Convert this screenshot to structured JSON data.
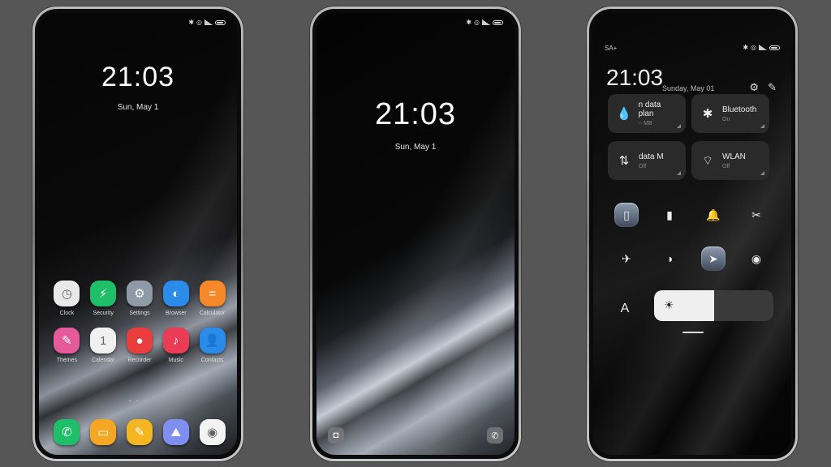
{
  "background_color": "#565656",
  "home_screen": {
    "time": "21:03",
    "date": "Sun, May 1",
    "apps": [
      {
        "label": "Clock",
        "icon": "clock-icon",
        "glyph": "◷",
        "color": "#e9e9e9"
      },
      {
        "label": "Security",
        "icon": "shield-icon",
        "glyph": "⚡",
        "color": "#1fbf6a"
      },
      {
        "label": "Settings",
        "icon": "gear-icon",
        "glyph": "⚙",
        "color": "#8e9aa6"
      },
      {
        "label": "Browser",
        "icon": "globe-icon",
        "glyph": "◐",
        "color": "#2a8be8"
      },
      {
        "label": "Calculator",
        "icon": "calculator-icon",
        "glyph": "=",
        "color": "#f5892a"
      },
      {
        "label": "Themes",
        "icon": "brush-icon",
        "glyph": "✎",
        "color": "#e55a9b"
      },
      {
        "label": "Calendar",
        "icon": "calendar-icon",
        "glyph": "1",
        "color": "#f0f0f0"
      },
      {
        "label": "Recorder",
        "icon": "record-icon",
        "glyph": "●",
        "color": "#ea3d3d"
      },
      {
        "label": "Music",
        "icon": "music-note-icon",
        "glyph": "♪",
        "color": "#ea3d55"
      },
      {
        "label": "Contacts",
        "icon": "contact-icon",
        "glyph": "👤",
        "color": "#2a8be8"
      }
    ],
    "page_dots": "• • •",
    "dock": [
      {
        "name": "phone",
        "icon": "phone-icon",
        "glyph": "✆",
        "color": "#1fbf6a"
      },
      {
        "name": "messages",
        "icon": "message-icon",
        "glyph": "▭",
        "color": "#f5a623"
      },
      {
        "name": "notes",
        "icon": "pencil-icon",
        "glyph": "✎",
        "color": "#f5b623"
      },
      {
        "name": "gallery",
        "icon": "gallery-icon",
        "glyph": "⛰",
        "color": "#7f8ff0"
      },
      {
        "name": "camera",
        "icon": "camera-icon",
        "glyph": "◉",
        "color": "#f3f3f3"
      }
    ]
  },
  "lock_screen": {
    "time": "21:03",
    "date": "Sun, May 1",
    "camera_glyph": "◘",
    "phone_glyph": "✆"
  },
  "control_center": {
    "carrier": "SA+",
    "time": "21:03",
    "date": "Sunday, May 01",
    "tiles": [
      {
        "title": "n data plan",
        "sub": "-- MB",
        "icon": "water-drop-icon",
        "glyph": "💧",
        "icon_color": "#3fa0e0"
      },
      {
        "title": "Bluetooth",
        "sub": "On",
        "icon": "bluetooth-icon",
        "glyph": "✱",
        "icon_color": "#eeeeee"
      },
      {
        "title": "data      M",
        "sub": "Off",
        "icon": "mobile-data-icon",
        "glyph": "⇅",
        "icon_color": "#eeeeee"
      },
      {
        "title": "WLAN",
        "sub": "Off",
        "icon": "wifi-icon",
        "glyph": "⌔",
        "icon_color": "#eeeeee"
      }
    ],
    "toggles_row1": [
      {
        "name": "vibrate",
        "icon": "vibrate-icon",
        "glyph": "▯",
        "on": true
      },
      {
        "name": "flashlight",
        "icon": "flashlight-icon",
        "glyph": "▮",
        "on": false
      },
      {
        "name": "sound",
        "icon": "bell-icon",
        "glyph": "🔔",
        "on": false
      },
      {
        "name": "screenshot",
        "icon": "scissors-icon",
        "glyph": "✂",
        "on": false
      }
    ],
    "toggles_row2": [
      {
        "name": "airplane",
        "icon": "airplane-icon",
        "glyph": "✈",
        "on": false
      },
      {
        "name": "dark-mode",
        "icon": "contrast-icon",
        "glyph": "◑",
        "on": false
      },
      {
        "name": "location",
        "icon": "location-arrow-icon",
        "glyph": "➤",
        "on": true
      },
      {
        "name": "reading-mode",
        "icon": "eye-icon",
        "glyph": "◉",
        "on": false
      }
    ],
    "auto_brightness_label": "A",
    "brightness_percent": 50,
    "brightness_glyph": "☀"
  }
}
